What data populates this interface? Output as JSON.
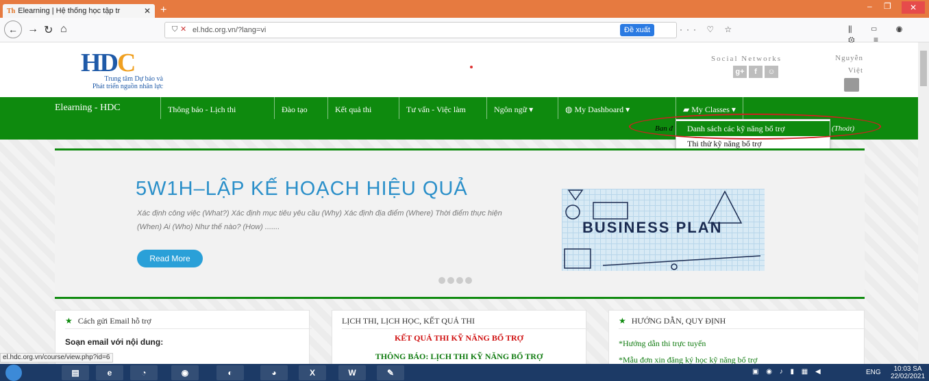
{
  "browser": {
    "tab_title": "Elearning | Hệ thống học tập tr",
    "favicon_text": "Th",
    "url": "el.hdc.org.vn/?lang=vi",
    "suggest_label": "Đề xuất",
    "status_url": "el.hdc.org.vn/course/view.php?id=6"
  },
  "header": {
    "logo_text": "HD",
    "logo_accent": "C",
    "logo_sub_1": "Trung tâm Dự báo và",
    "logo_sub_2": "Phát triển nguồn nhân lực",
    "social_title": "Social Networks",
    "user_first": "Nguyễn",
    "user_last": "Việt"
  },
  "nav": {
    "brand": "Elearning - HDC",
    "items": [
      "Thông báo - Lịch thi",
      "Đào tạo",
      "Kết quả thi",
      "Tư vấn - Việc làm",
      "Ngôn ngữ ▾",
      "My Dashboard ▾",
      "My Classes ▾"
    ],
    "logged_in": "Ban đ",
    "logout": "(Thoát)",
    "dropdown": [
      "Danh sách các kỹ năng bổ trợ",
      "Thi thử kỹ năng bổ trợ"
    ]
  },
  "slider": {
    "title": "5W1H–LẬP KẾ HOẠCH HIỆU QUẢ",
    "desc": "Xác định công việc (What?) Xác định mục tiêu yêu cầu (Why) Xác định địa điểm (Where) Thời điểm thực hiện (When) Ai (Who) Như thế nào? (How) .......",
    "read_more": "Read More",
    "image_text": "BUSINESS PLAN"
  },
  "boxes": {
    "box1_title": "Cách gửi Email hỗ trợ",
    "box1_line1": "Soạn email với nội dung:",
    "box2_title": "LỊCH THI, LỊCH HỌC, KẾT QUẢ THI",
    "box2_line1": "KẾT QUẢ THI KỸ NĂNG BỔ TRỢ",
    "box2_line2": "THÔNG BÁO: LỊCH THI KỸ NĂNG BỔ TRỢ",
    "box3_title": "HƯỚNG DẪN, QUY ĐỊNH",
    "box3_line1": "*Hướng dẫn thi trực tuyến",
    "box3_line2": "*Mẫu đơn xin đăng ký học kỹ năng bổ trợ"
  },
  "taskbar": {
    "lang": "ENG",
    "time": "10:03 SA",
    "date": "22/02/2021"
  },
  "colors": {
    "nav_green": "#0e8a0e",
    "accent_blue": "#2aa0d8",
    "highlight_red": "#d02020"
  }
}
